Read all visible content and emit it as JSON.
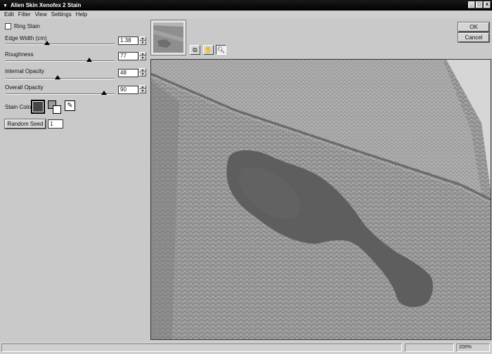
{
  "window": {
    "title": "Alien Skin Xenofex 2 Stain"
  },
  "menu": [
    "Edit",
    "Filter",
    "View",
    "Settings",
    "Help"
  ],
  "controls": {
    "ring_stain": {
      "label": "Ring Stain",
      "checked": false
    },
    "edge_width": {
      "label": "Edge Width (cm)",
      "value": "1.38",
      "level": 0.38
    },
    "roughness": {
      "label": "Roughness",
      "value": "77",
      "level": 0.77
    },
    "internal_opacity": {
      "label": "Internal Opacity",
      "value": "48",
      "level": 0.48
    },
    "overall_opacity": {
      "label": "Overall Opacity",
      "value": "90",
      "level": 0.9
    },
    "stain_color": {
      "label": "Stain Color",
      "color": "#454545"
    },
    "random_seed": {
      "label": "Random Seed",
      "value": "1"
    }
  },
  "buttons": {
    "ok": "OK",
    "cancel": "Cancel"
  },
  "tools": [
    "compare-icon",
    "hand-icon",
    "zoom-icon"
  ],
  "status": {
    "zoom": "200%"
  }
}
